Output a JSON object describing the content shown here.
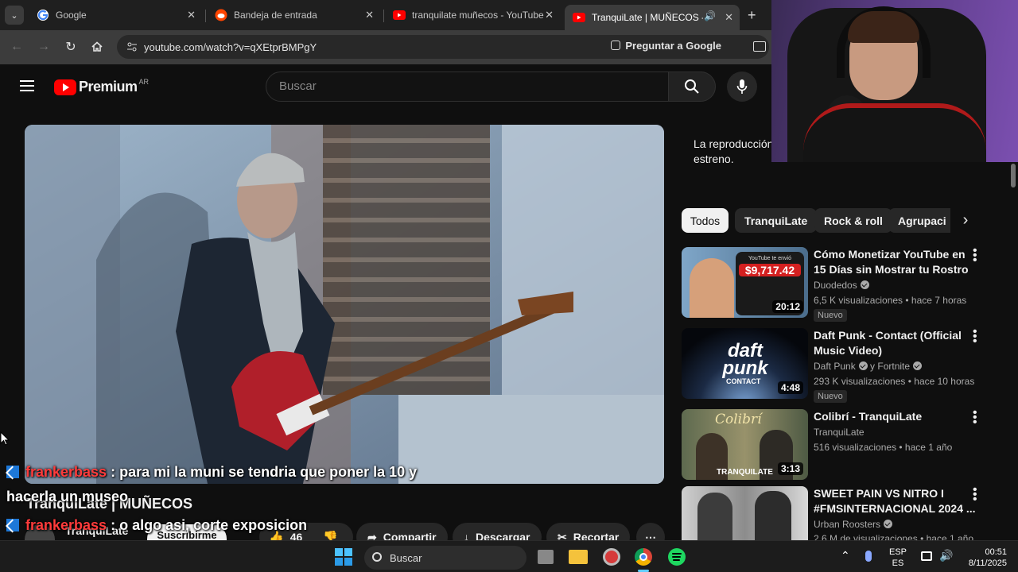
{
  "browser": {
    "tabs": [
      {
        "title": "Google",
        "icon": "google-icon"
      },
      {
        "title": "Bandeja de entrada",
        "icon": "reddit-icon"
      },
      {
        "title": "tranquilate muñecos - YouTube",
        "icon": "youtube-icon"
      },
      {
        "title": "TranquiLate | MUÑECOS - Y",
        "icon": "youtube-icon",
        "active": true
      }
    ],
    "url": "youtube.com/watch?v=qXEtprBMPgY",
    "ask_google": "Preguntar a Google"
  },
  "youtube": {
    "logo_text": "Premium",
    "region": "AR",
    "search_placeholder": "Buscar",
    "video_title": "TranquiLate | MUÑECOS",
    "channel_name": "TranquiLate",
    "subscribe_label": "Suscribirme",
    "like_count": "46",
    "share_label": "Compartir",
    "download_label": "Descargar",
    "clip_label": "Recortar",
    "side_note": [
      "La reproducción",
      "estreno."
    ],
    "chips": [
      "Todos",
      "TranquiLate",
      "Rock & roll",
      "Agrupaci"
    ],
    "recommendations": [
      {
        "title": "Cómo Monetizar YouTube en 15 Días sin Mostrar tu Rostro",
        "channel": "Duodedos",
        "meta": "6,5 K visualizaciones • hace 7 horas",
        "badge": "Nuevo",
        "duration": "20:12",
        "thumb_text": "$9,717.42",
        "thumb_sub": "YouTube te envió"
      },
      {
        "title": "Daft Punk - Contact (Official Music Video)",
        "channel": "Daft Punk",
        "channel2": "y Fortnite",
        "meta": "293 K visualizaciones • hace 10 horas",
        "badge": "Nuevo",
        "duration": "4:48",
        "thumb_text": "daft punk",
        "thumb_sub": "CONTACT"
      },
      {
        "title": "Colibrí - TranquiLate",
        "channel": "TranquiLate",
        "meta": "516 visualizaciones • hace 1 año",
        "duration": "3:13",
        "thumb_text": "Colibrí",
        "thumb_sub": "TRANQUILATE"
      },
      {
        "title": "SWEET PAIN VS NITRO I #FMSINTERNACIONAL 2024 ...",
        "channel": "Urban Roosters",
        "meta": "2,6 M de visualizaciones • hace 1 año"
      }
    ]
  },
  "chat": [
    {
      "user": "frankerbass",
      "message": ": para mi la muni se tendria que poner la 10 y"
    },
    {
      "user": "",
      "message": "hacerla un museo"
    },
    {
      "user": "frankerbass",
      "message": ": o algo asi, corte exposicion"
    }
  ],
  "taskbar": {
    "search_label": "Buscar",
    "lang_top": "ESP",
    "lang_bottom": "ES",
    "time": "00:51",
    "date": "8/11/2025"
  },
  "colors": {
    "accent": "#ff0000",
    "chat_user": "#ff3b3b",
    "background": "#0f0f0f"
  }
}
